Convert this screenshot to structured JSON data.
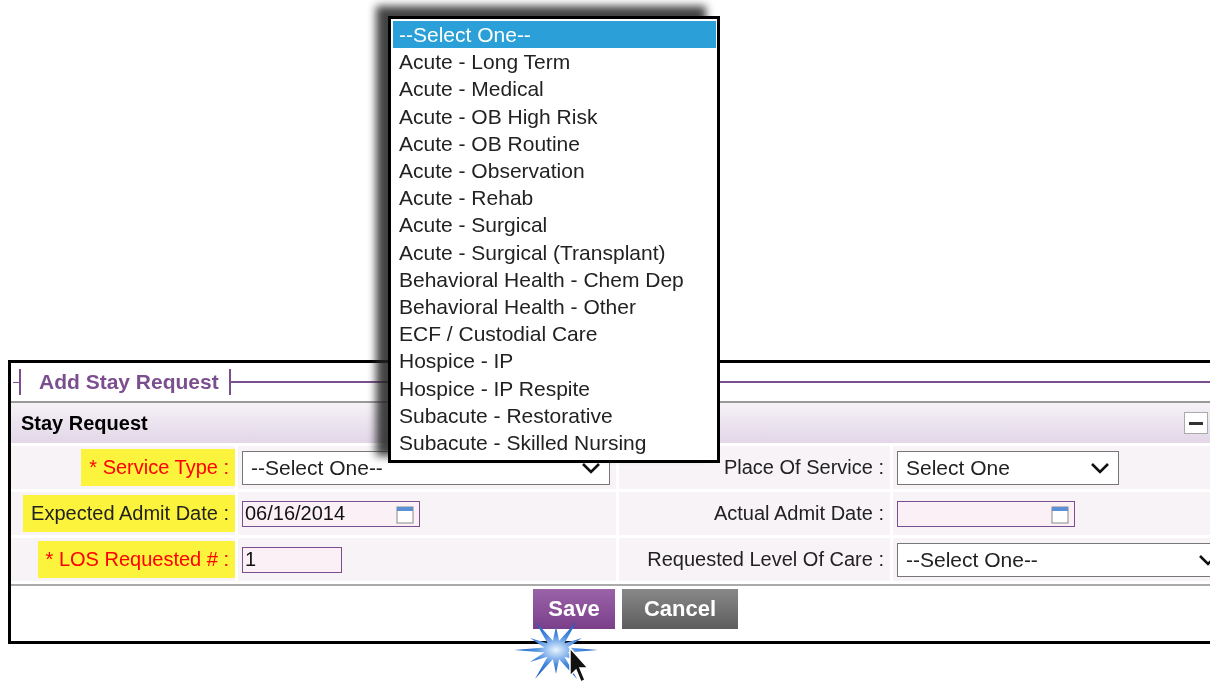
{
  "dropdown": {
    "options": [
      {
        "label": "--Select One--",
        "selected": true
      },
      {
        "label": "Acute - Long Term",
        "selected": false
      },
      {
        "label": "Acute - Medical",
        "selected": false
      },
      {
        "label": "Acute - OB High Risk",
        "selected": false
      },
      {
        "label": "Acute - OB Routine",
        "selected": false
      },
      {
        "label": "Acute - Observation",
        "selected": false
      },
      {
        "label": "Acute - Rehab",
        "selected": false
      },
      {
        "label": "Acute - Surgical",
        "selected": false
      },
      {
        "label": "Acute - Surgical (Transplant)",
        "selected": false
      },
      {
        "label": "Behavioral Health - Chem Dep",
        "selected": false
      },
      {
        "label": "Behavioral Health - Other",
        "selected": false
      },
      {
        "label": "ECF / Custodial Care",
        "selected": false
      },
      {
        "label": "Hospice - IP",
        "selected": false
      },
      {
        "label": "Hospice - IP Respite",
        "selected": false
      },
      {
        "label": "Subacute - Restorative",
        "selected": false
      },
      {
        "label": "Subacute - Skilled Nursing",
        "selected": false
      }
    ]
  },
  "form": {
    "legend": "Add Stay Request",
    "section": {
      "title": "Stay Request",
      "expanded": true
    },
    "rows": [
      {
        "left": {
          "label": "* Service Type :",
          "required": true,
          "highlighted": true,
          "kind": "select",
          "value": "--Select One--"
        },
        "right": {
          "label": "Place Of Service :",
          "required": false,
          "highlighted": false,
          "kind": "select",
          "value": "Select One"
        }
      },
      {
        "left": {
          "label": "Expected Admit Date :",
          "required": false,
          "highlighted": true,
          "kind": "date",
          "value": "06/16/2014"
        },
        "right": {
          "label": "Actual Admit Date :",
          "required": false,
          "highlighted": false,
          "kind": "date"
        }
      },
      {
        "left": {
          "label": "* LOS Requested # :",
          "required": true,
          "highlighted": true,
          "kind": "text",
          "value": "1"
        },
        "right": {
          "label": "Requested Level Of Care :",
          "required": false,
          "highlighted": false,
          "kind": "select",
          "value": "--Select One--"
        }
      }
    ],
    "buttons": [
      {
        "label": "Save",
        "kind": "primary"
      },
      {
        "label": "Cancel",
        "kind": "secondary"
      }
    ]
  }
}
